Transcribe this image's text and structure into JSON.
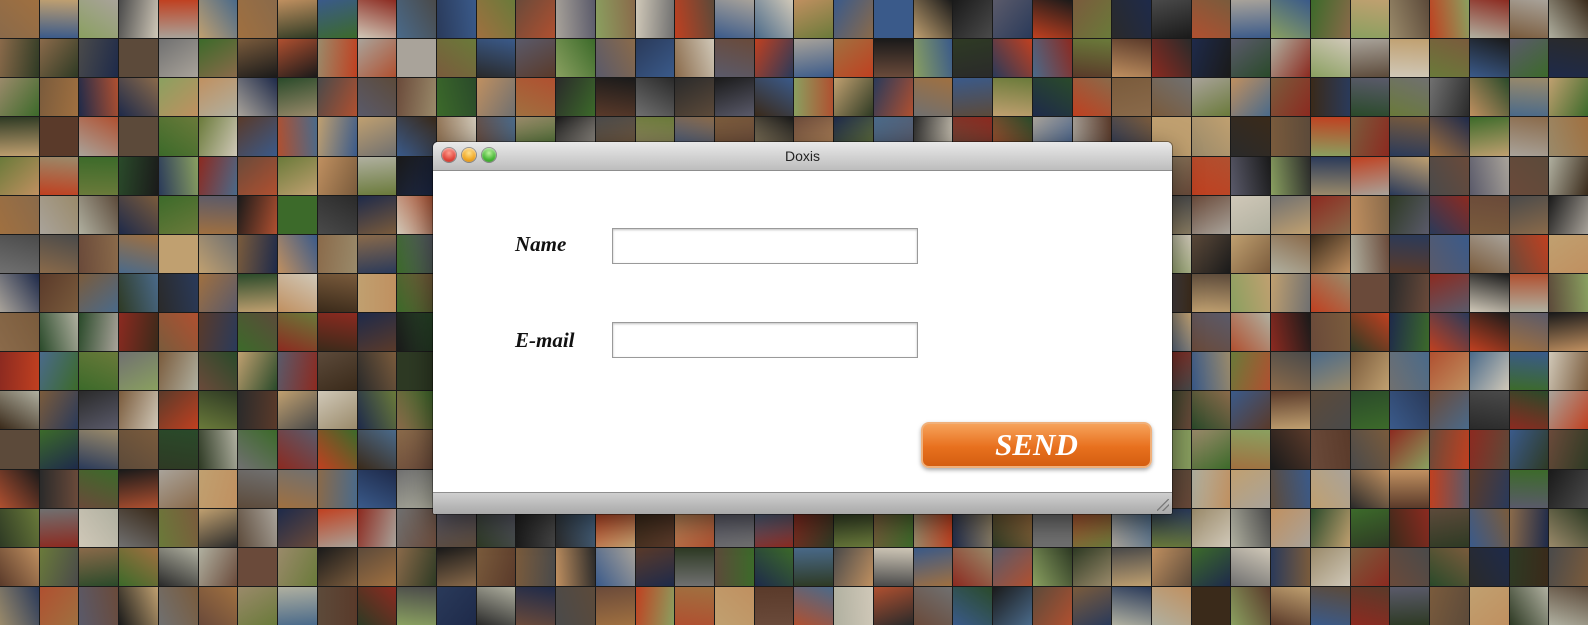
{
  "window": {
    "title": "Doxis"
  },
  "form": {
    "name_label": "Name",
    "email_label": "E-mail",
    "name_value": "",
    "email_value": "",
    "send_label": "SEND"
  },
  "colors": {
    "send_button": "#e8701e",
    "close_light": "#e0453a",
    "minimize_light": "#f0a724",
    "maximize_light": "#45b534"
  },
  "background": {
    "description_icon": "photo-mosaic",
    "tile_colors": [
      "#7a5b3c",
      "#2e3a24",
      "#a9a39a",
      "#3c6a2a",
      "#5c4a3a",
      "#8c2a20",
      "#1e2a4a",
      "#c0a070",
      "#4a4a4a",
      "#6a7a3a",
      "#b05030",
      "#2a2a2a",
      "#d0c8b8",
      "#3a5a8a",
      "#8a6a4a",
      "#5a3a2a",
      "#a07040",
      "#2a4a2a",
      "#707070",
      "#c04020",
      "#4a6a8a",
      "#9a8a6a",
      "#1a1a1a",
      "#6a4a3a",
      "#b0b0a0",
      "#3a2a1a",
      "#8aa060",
      "#5a5a6a",
      "#c09060",
      "#2a3a5a"
    ]
  }
}
